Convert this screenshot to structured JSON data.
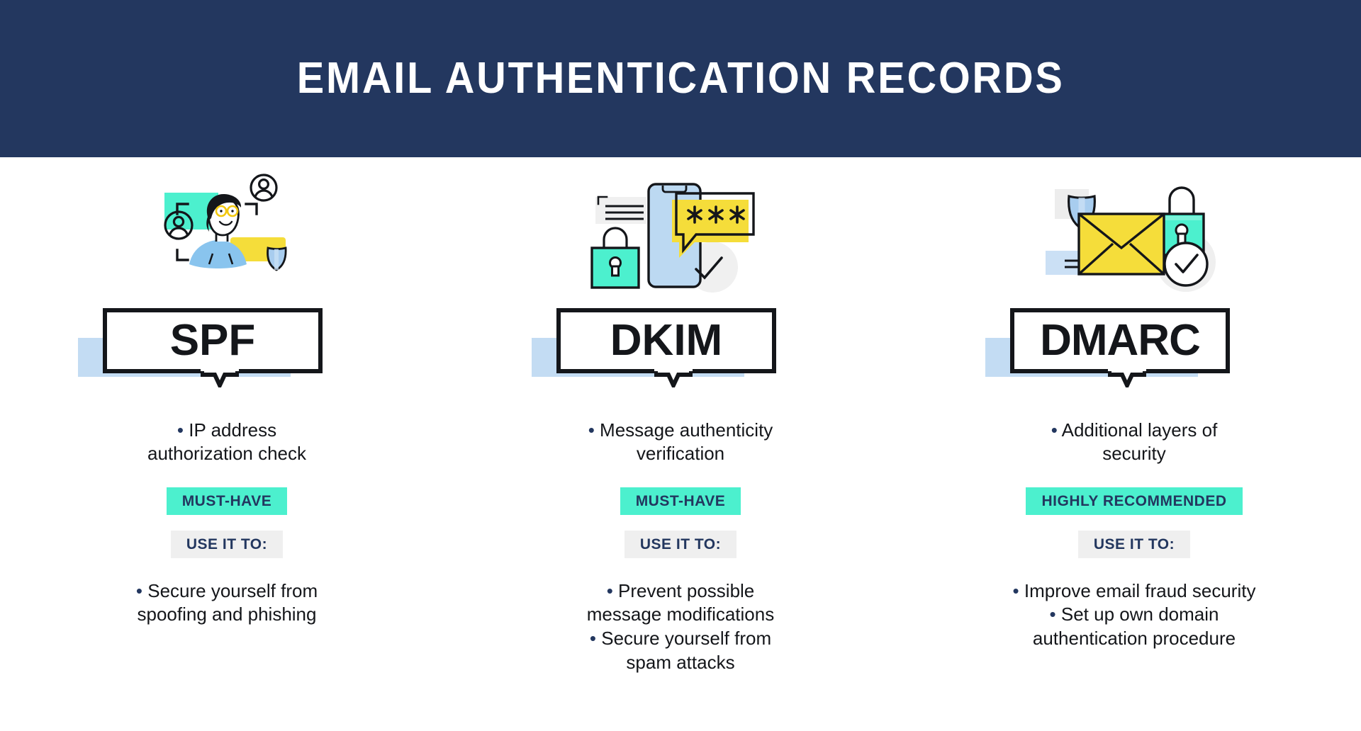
{
  "header": {
    "title": "EMAIL AUTHENTICATION RECORDS",
    "background_color": "#23375F",
    "text_color": "#FFFFFF"
  },
  "palette": {
    "navy": "#23375F",
    "teal": "#4CF0CE",
    "yellow": "#F5DD3A",
    "light_blue": "#A8CDEF",
    "plate_shadow_blue": "#C3DCF3",
    "badge_gray": "#EFEFEF",
    "ink": "#14161A"
  },
  "columns": [
    {
      "id": "spf",
      "illustration_name": "spf-identity-verification-illustration",
      "label": "SPF",
      "features": [
        {
          "bullet": "•",
          "text": "IP address"
        },
        {
          "bullet": "",
          "text": "authorization check"
        }
      ],
      "status_badge": "MUST-HAVE",
      "use_badge": "USE IT TO:",
      "uses": [
        {
          "bullet": "•",
          "text": "Secure yourself from"
        },
        {
          "bullet": "",
          "text": "spoofing and phishing"
        }
      ]
    },
    {
      "id": "dkim",
      "illustration_name": "dkim-phone-password-illustration",
      "label": "DKIM",
      "features": [
        {
          "bullet": "•",
          "text": "Message authenticity"
        },
        {
          "bullet": "",
          "text": "verification"
        }
      ],
      "status_badge": "MUST-HAVE",
      "use_badge": "USE IT TO:",
      "uses": [
        {
          "bullet": "•",
          "text": "Prevent possible"
        },
        {
          "bullet": "",
          "text": "message modifications"
        },
        {
          "bullet": "•",
          "text": "Secure yourself from"
        },
        {
          "bullet": "",
          "text": "spam attacks"
        }
      ]
    },
    {
      "id": "dmarc",
      "illustration_name": "dmarc-secured-envelope-illustration",
      "label": "DMARC",
      "features": [
        {
          "bullet": "•",
          "text": "Additional layers of"
        },
        {
          "bullet": "",
          "text": "security"
        }
      ],
      "status_badge": "HIGHLY RECOMMENDED",
      "use_badge": "USE IT TO:",
      "uses": [
        {
          "bullet": "•",
          "text": "Improve email fraud security"
        },
        {
          "bullet": "•",
          "text": "Set up own domain"
        },
        {
          "bullet": "",
          "text": "authentication procedure"
        }
      ]
    }
  ],
  "illustration_elements": {
    "spf": [
      "teal-rectangle",
      "user-avatar-icon",
      "user-avatar-icon",
      "person-with-glasses",
      "yellow-rectangle",
      "shield-icon",
      "focus-bracket",
      "focus-bracket",
      "focus-bracket",
      "focus-bracket"
    ],
    "dkim": [
      "document-lines",
      "smartphone",
      "speech-bubble-asterisks",
      "padlock-icon",
      "check-mark"
    ],
    "dmarc": [
      "shield-icon",
      "yellow-envelope",
      "padlock-icon",
      "check-circle-icon",
      "document-lines"
    ]
  }
}
